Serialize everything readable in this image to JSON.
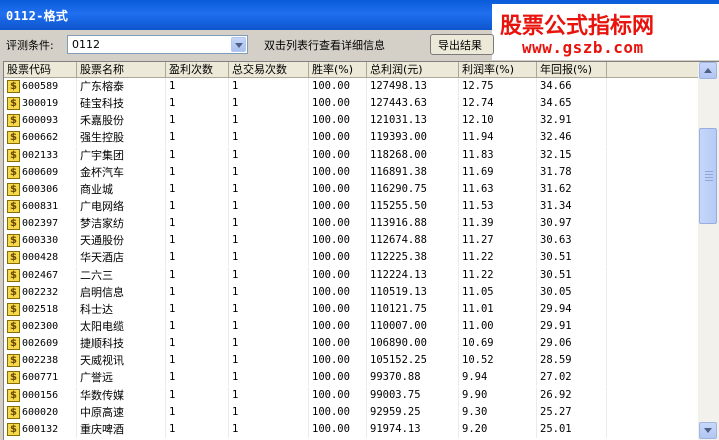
{
  "window": {
    "title": "0112-格式"
  },
  "watermark": {
    "title": "股票公式指标网",
    "url": "www.gszb.com",
    "color": "#e8130c"
  },
  "toolbar": {
    "filter_label": "评测条件:",
    "filter_value": "0112",
    "hint": "双击列表行查看详细信息",
    "export_label": "导出结果"
  },
  "columns": [
    "股票代码",
    "股票名称",
    "盈利次数",
    "总交易次数",
    "胜率(%)",
    "总利润(元)",
    "利润率(%)",
    "年回报(%)"
  ],
  "rows": [
    {
      "code": "600589",
      "name": "广东榕泰",
      "wins": "1",
      "trades": "1",
      "win_rate": "100.00",
      "profit": "127498.13",
      "profit_rate": "12.75",
      "annual": "34.66"
    },
    {
      "code": "300019",
      "name": "硅宝科技",
      "wins": "1",
      "trades": "1",
      "win_rate": "100.00",
      "profit": "127443.63",
      "profit_rate": "12.74",
      "annual": "34.65"
    },
    {
      "code": "600093",
      "name": "禾嘉股份",
      "wins": "1",
      "trades": "1",
      "win_rate": "100.00",
      "profit": "121031.13",
      "profit_rate": "12.10",
      "annual": "32.91"
    },
    {
      "code": "600662",
      "name": "强生控股",
      "wins": "1",
      "trades": "1",
      "win_rate": "100.00",
      "profit": "119393.00",
      "profit_rate": "11.94",
      "annual": "32.46"
    },
    {
      "code": "002133",
      "name": "广宇集团",
      "wins": "1",
      "trades": "1",
      "win_rate": "100.00",
      "profit": "118268.00",
      "profit_rate": "11.83",
      "annual": "32.15"
    },
    {
      "code": "600609",
      "name": "金杯汽车",
      "wins": "1",
      "trades": "1",
      "win_rate": "100.00",
      "profit": "116891.38",
      "profit_rate": "11.69",
      "annual": "31.78"
    },
    {
      "code": "600306",
      "name": "商业城",
      "wins": "1",
      "trades": "1",
      "win_rate": "100.00",
      "profit": "116290.75",
      "profit_rate": "11.63",
      "annual": "31.62"
    },
    {
      "code": "600831",
      "name": "广电网络",
      "wins": "1",
      "trades": "1",
      "win_rate": "100.00",
      "profit": "115255.50",
      "profit_rate": "11.53",
      "annual": "31.34"
    },
    {
      "code": "002397",
      "name": "梦洁家纺",
      "wins": "1",
      "trades": "1",
      "win_rate": "100.00",
      "profit": "113916.88",
      "profit_rate": "11.39",
      "annual": "30.97"
    },
    {
      "code": "600330",
      "name": "天通股份",
      "wins": "1",
      "trades": "1",
      "win_rate": "100.00",
      "profit": "112674.88",
      "profit_rate": "11.27",
      "annual": "30.63"
    },
    {
      "code": "000428",
      "name": "华天酒店",
      "wins": "1",
      "trades": "1",
      "win_rate": "100.00",
      "profit": "112225.38",
      "profit_rate": "11.22",
      "annual": "30.51"
    },
    {
      "code": "002467",
      "name": "二六三",
      "wins": "1",
      "trades": "1",
      "win_rate": "100.00",
      "profit": "112224.13",
      "profit_rate": "11.22",
      "annual": "30.51"
    },
    {
      "code": "002232",
      "name": "启明信息",
      "wins": "1",
      "trades": "1",
      "win_rate": "100.00",
      "profit": "110519.13",
      "profit_rate": "11.05",
      "annual": "30.05"
    },
    {
      "code": "002518",
      "name": "科士达",
      "wins": "1",
      "trades": "1",
      "win_rate": "100.00",
      "profit": "110121.75",
      "profit_rate": "11.01",
      "annual": "29.94"
    },
    {
      "code": "002300",
      "name": "太阳电缆",
      "wins": "1",
      "trades": "1",
      "win_rate": "100.00",
      "profit": "110007.00",
      "profit_rate": "11.00",
      "annual": "29.91"
    },
    {
      "code": "002609",
      "name": "捷顺科技",
      "wins": "1",
      "trades": "1",
      "win_rate": "100.00",
      "profit": "106890.00",
      "profit_rate": "10.69",
      "annual": "29.06"
    },
    {
      "code": "002238",
      "name": "天威视讯",
      "wins": "1",
      "trades": "1",
      "win_rate": "100.00",
      "profit": "105152.25",
      "profit_rate": "10.52",
      "annual": "28.59"
    },
    {
      "code": "600771",
      "name": "广誉远",
      "wins": "1",
      "trades": "1",
      "win_rate": "100.00",
      "profit": "99370.88",
      "profit_rate": "9.94",
      "annual": "27.02"
    },
    {
      "code": "000156",
      "name": "华数传媒",
      "wins": "1",
      "trades": "1",
      "win_rate": "100.00",
      "profit": "99003.75",
      "profit_rate": "9.90",
      "annual": "26.92"
    },
    {
      "code": "600020",
      "name": "中原高速",
      "wins": "1",
      "trades": "1",
      "win_rate": "100.00",
      "profit": "92959.25",
      "profit_rate": "9.30",
      "annual": "25.27"
    },
    {
      "code": "600132",
      "name": "重庆啤酒",
      "wins": "1",
      "trades": "1",
      "win_rate": "100.00",
      "profit": "91974.13",
      "profit_rate": "9.20",
      "annual": "25.01"
    }
  ],
  "icons": {
    "row_icon": "dollar-icon",
    "row_icon_glyph": "$"
  },
  "colors": {
    "titlebar": "#0a5bd8",
    "watermark": "#e8130c"
  }
}
